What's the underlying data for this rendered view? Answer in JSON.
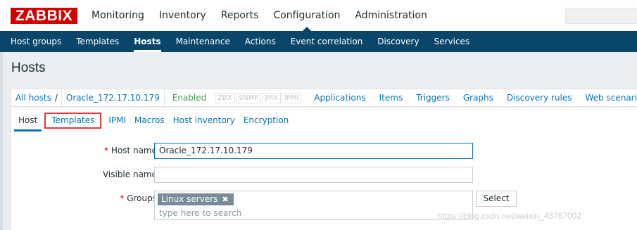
{
  "header": {
    "logo": "ZABBIX",
    "menu": [
      "Monitoring",
      "Inventory",
      "Reports",
      "Configuration",
      "Administration"
    ],
    "active_menu": "Configuration"
  },
  "submenu": {
    "items": [
      "Host groups",
      "Templates",
      "Hosts",
      "Maintenance",
      "Actions",
      "Event correlation",
      "Discovery",
      "Services"
    ],
    "active": "Hosts"
  },
  "page": {
    "title": "Hosts"
  },
  "nav": {
    "all_hosts": "All hosts",
    "separator": "/",
    "host": "Oracle_172.17.10.179",
    "status": "Enabled",
    "badges": [
      "ZBX",
      "SNMP",
      "JMX",
      "IPMI"
    ],
    "links": [
      "Applications",
      "Items",
      "Triggers",
      "Graphs",
      "Discovery rules",
      "Web scenarios"
    ]
  },
  "tabs": {
    "items": [
      "Host",
      "Templates",
      "IPMI",
      "Macros",
      "Host inventory",
      "Encryption"
    ],
    "active": "Host",
    "highlighted": "Templates"
  },
  "form": {
    "host_name_label": "Host name",
    "host_name_value": "Oracle_172.17.10.179",
    "visible_name_label": "Visible name",
    "visible_name_value": "",
    "groups_label": "Groups",
    "group_chip": "Linux servers",
    "chip_remove": "✖",
    "group_placeholder": "type here to search",
    "select_button": "Select",
    "required_mark": "*"
  },
  "watermark": "https://blog.csdn.net/weixin_43767002",
  "colors": {
    "brand": "#d40000",
    "nav_bg": "#0a466a",
    "link": "#0275b8",
    "enabled": "#429e47",
    "highlight_box": "#e03b3b"
  }
}
